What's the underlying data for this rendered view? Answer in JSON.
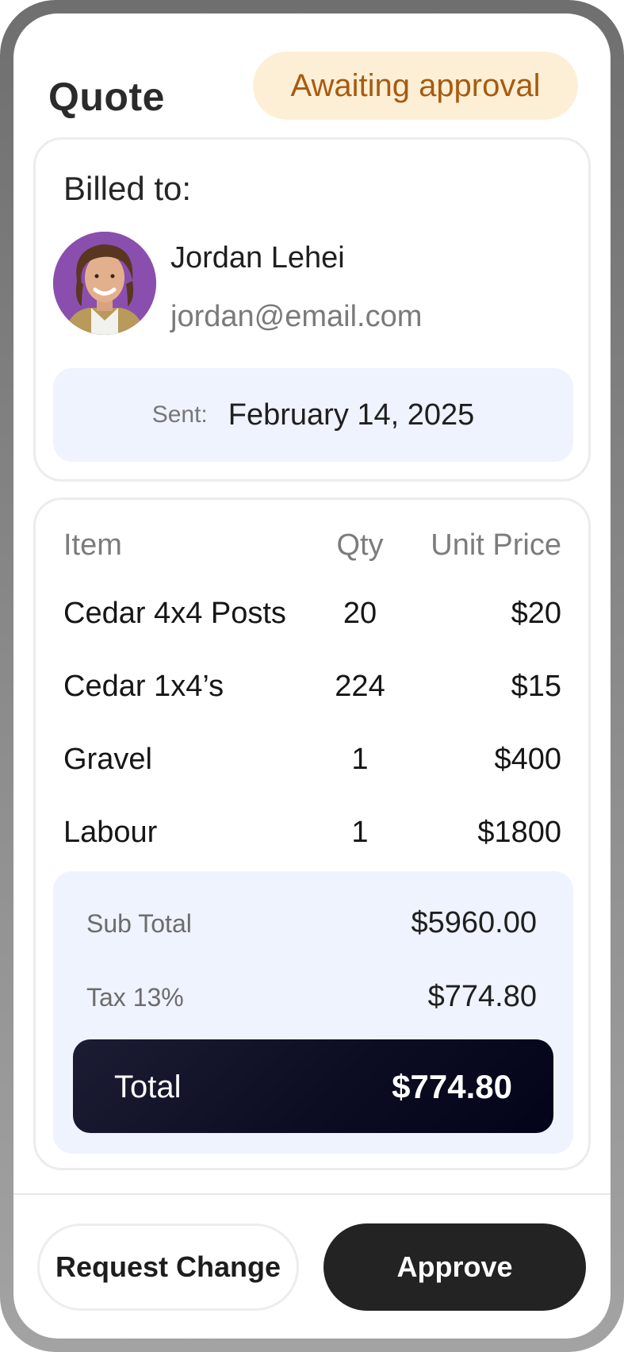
{
  "header": {
    "title": "Quote",
    "status": "Awaiting approval"
  },
  "billing": {
    "label": "Billed to:",
    "client_name": "Jordan Lehei",
    "client_email": "jordan@email.com",
    "sent_label": "Sent:",
    "sent_date": "February 14, 2025"
  },
  "items": {
    "headers": {
      "item": "Item",
      "qty": "Qty",
      "unit_price": "Unit Price"
    },
    "rows": [
      {
        "item": "Cedar 4x4 Posts",
        "qty": "20",
        "unit_price": "$20"
      },
      {
        "item": "Cedar 1x4’s",
        "qty": "224",
        "unit_price": "$15"
      },
      {
        "item": "Gravel",
        "qty": "1",
        "unit_price": "$400"
      },
      {
        "item": "Labour",
        "qty": "1",
        "unit_price": "$1800"
      }
    ]
  },
  "totals": {
    "subtotal_label": "Sub Total",
    "subtotal_value": "$5960.00",
    "tax_label": "Tax 13%",
    "tax_value": "$774.80",
    "total_label": "Total",
    "total_value": "$774.80"
  },
  "actions": {
    "request_change": "Request Change",
    "approve": "Approve"
  },
  "colors": {
    "status_badge_bg": "#fdefd6",
    "status_badge_text": "#a85b0e",
    "info_box_bg": "#eef3fd",
    "total_bar_bg": "#0c0c22",
    "primary_button_bg": "#232323"
  }
}
